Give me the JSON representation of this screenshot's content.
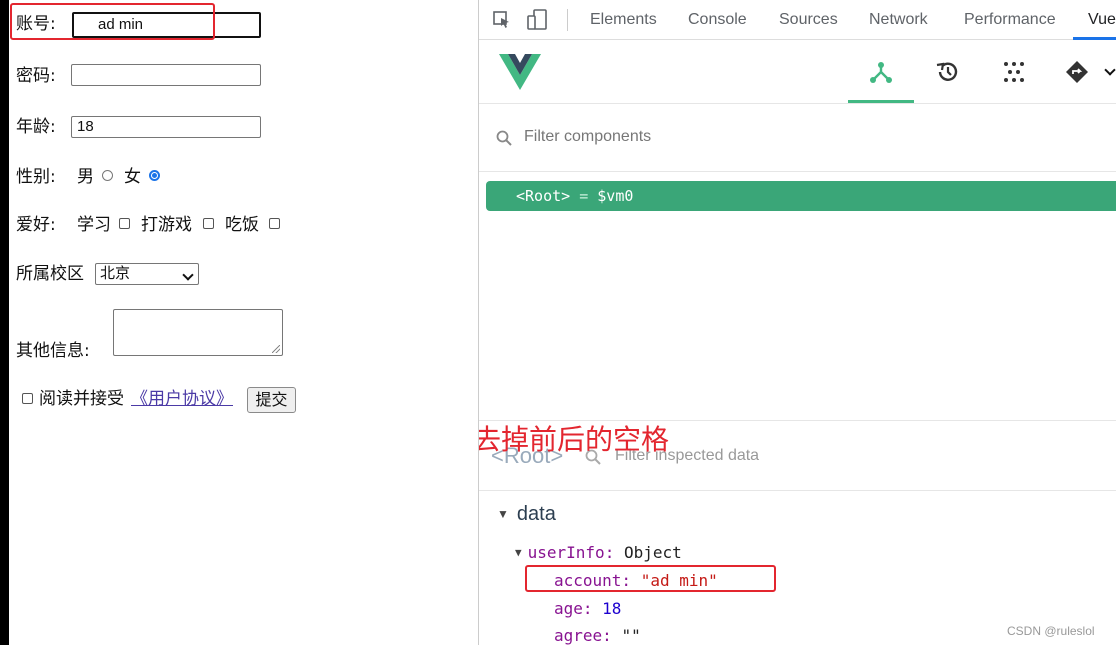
{
  "form": {
    "account": {
      "label": "账号:",
      "value": "ad min"
    },
    "password": {
      "label": "密码:",
      "value": ""
    },
    "age": {
      "label": "年龄:",
      "value": "18"
    },
    "gender": {
      "label": "性别:",
      "male": "男",
      "female": "女",
      "selected": "female"
    },
    "hobby": {
      "label": "爱好:",
      "options": [
        "学习",
        "打游戏",
        "吃饭"
      ]
    },
    "campus": {
      "label": "所属校区",
      "selected": "北京"
    },
    "other": {
      "label": "其他信息:"
    },
    "agree": {
      "text": "阅读并接受",
      "link": "《用户协议》"
    },
    "submit_label": "提交"
  },
  "devtools": {
    "tabs": [
      "Elements",
      "Console",
      "Sources",
      "Network",
      "Performance",
      "Vue"
    ],
    "active_tab": "Vue",
    "filter_placeholder": "Filter components",
    "root_row": {
      "tag": "<Root>",
      "eq": "=",
      "var": "$vm0"
    },
    "inspector": {
      "root_label": "<Root>",
      "filter_placeholder": "Filter inspected data",
      "section": "data",
      "object_key": "userInfo:",
      "object_type": "Object",
      "fields": [
        {
          "key": "account:",
          "value": "\"ad min\""
        },
        {
          "key": "age:",
          "value": "18"
        },
        {
          "key": "agree:",
          "value": "\"\""
        }
      ]
    }
  },
  "annotation": "去掉前后的空格",
  "watermark": "CSDN @ruleslol",
  "colors": {
    "vue_green": "#42b883",
    "annotation_red": "#e3262f"
  }
}
